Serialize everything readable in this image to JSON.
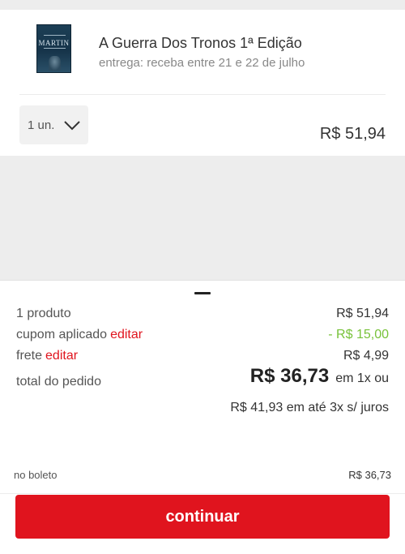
{
  "item": {
    "cover_author": "MARTIN",
    "title": "A Guerra Dos Tronos 1ª Edição",
    "delivery": "entrega: receba entre 21 e 22 de julho",
    "quantity": "1 un.",
    "price": "R$ 51,94"
  },
  "summary": {
    "products_label": "1 produto",
    "products_value": "R$ 51,94",
    "coupon_label": "cupom aplicado",
    "coupon_edit": "editar",
    "coupon_value": "- R$ 15,00",
    "shipping_label": "frete",
    "shipping_edit": "editar",
    "shipping_value": "R$ 4,99",
    "total_label": "total do pedido",
    "total_value": "R$ 36,73",
    "total_suffix": "em 1x ou",
    "installments": "R$ 41,93 em até 3x s/ juros",
    "boleto_label": "no boleto",
    "boleto_value": "R$ 36,73"
  },
  "actions": {
    "continue_label": "continuar"
  },
  "colors": {
    "accent": "#e0141e",
    "discount": "#78c23a",
    "background": "#ededed"
  }
}
